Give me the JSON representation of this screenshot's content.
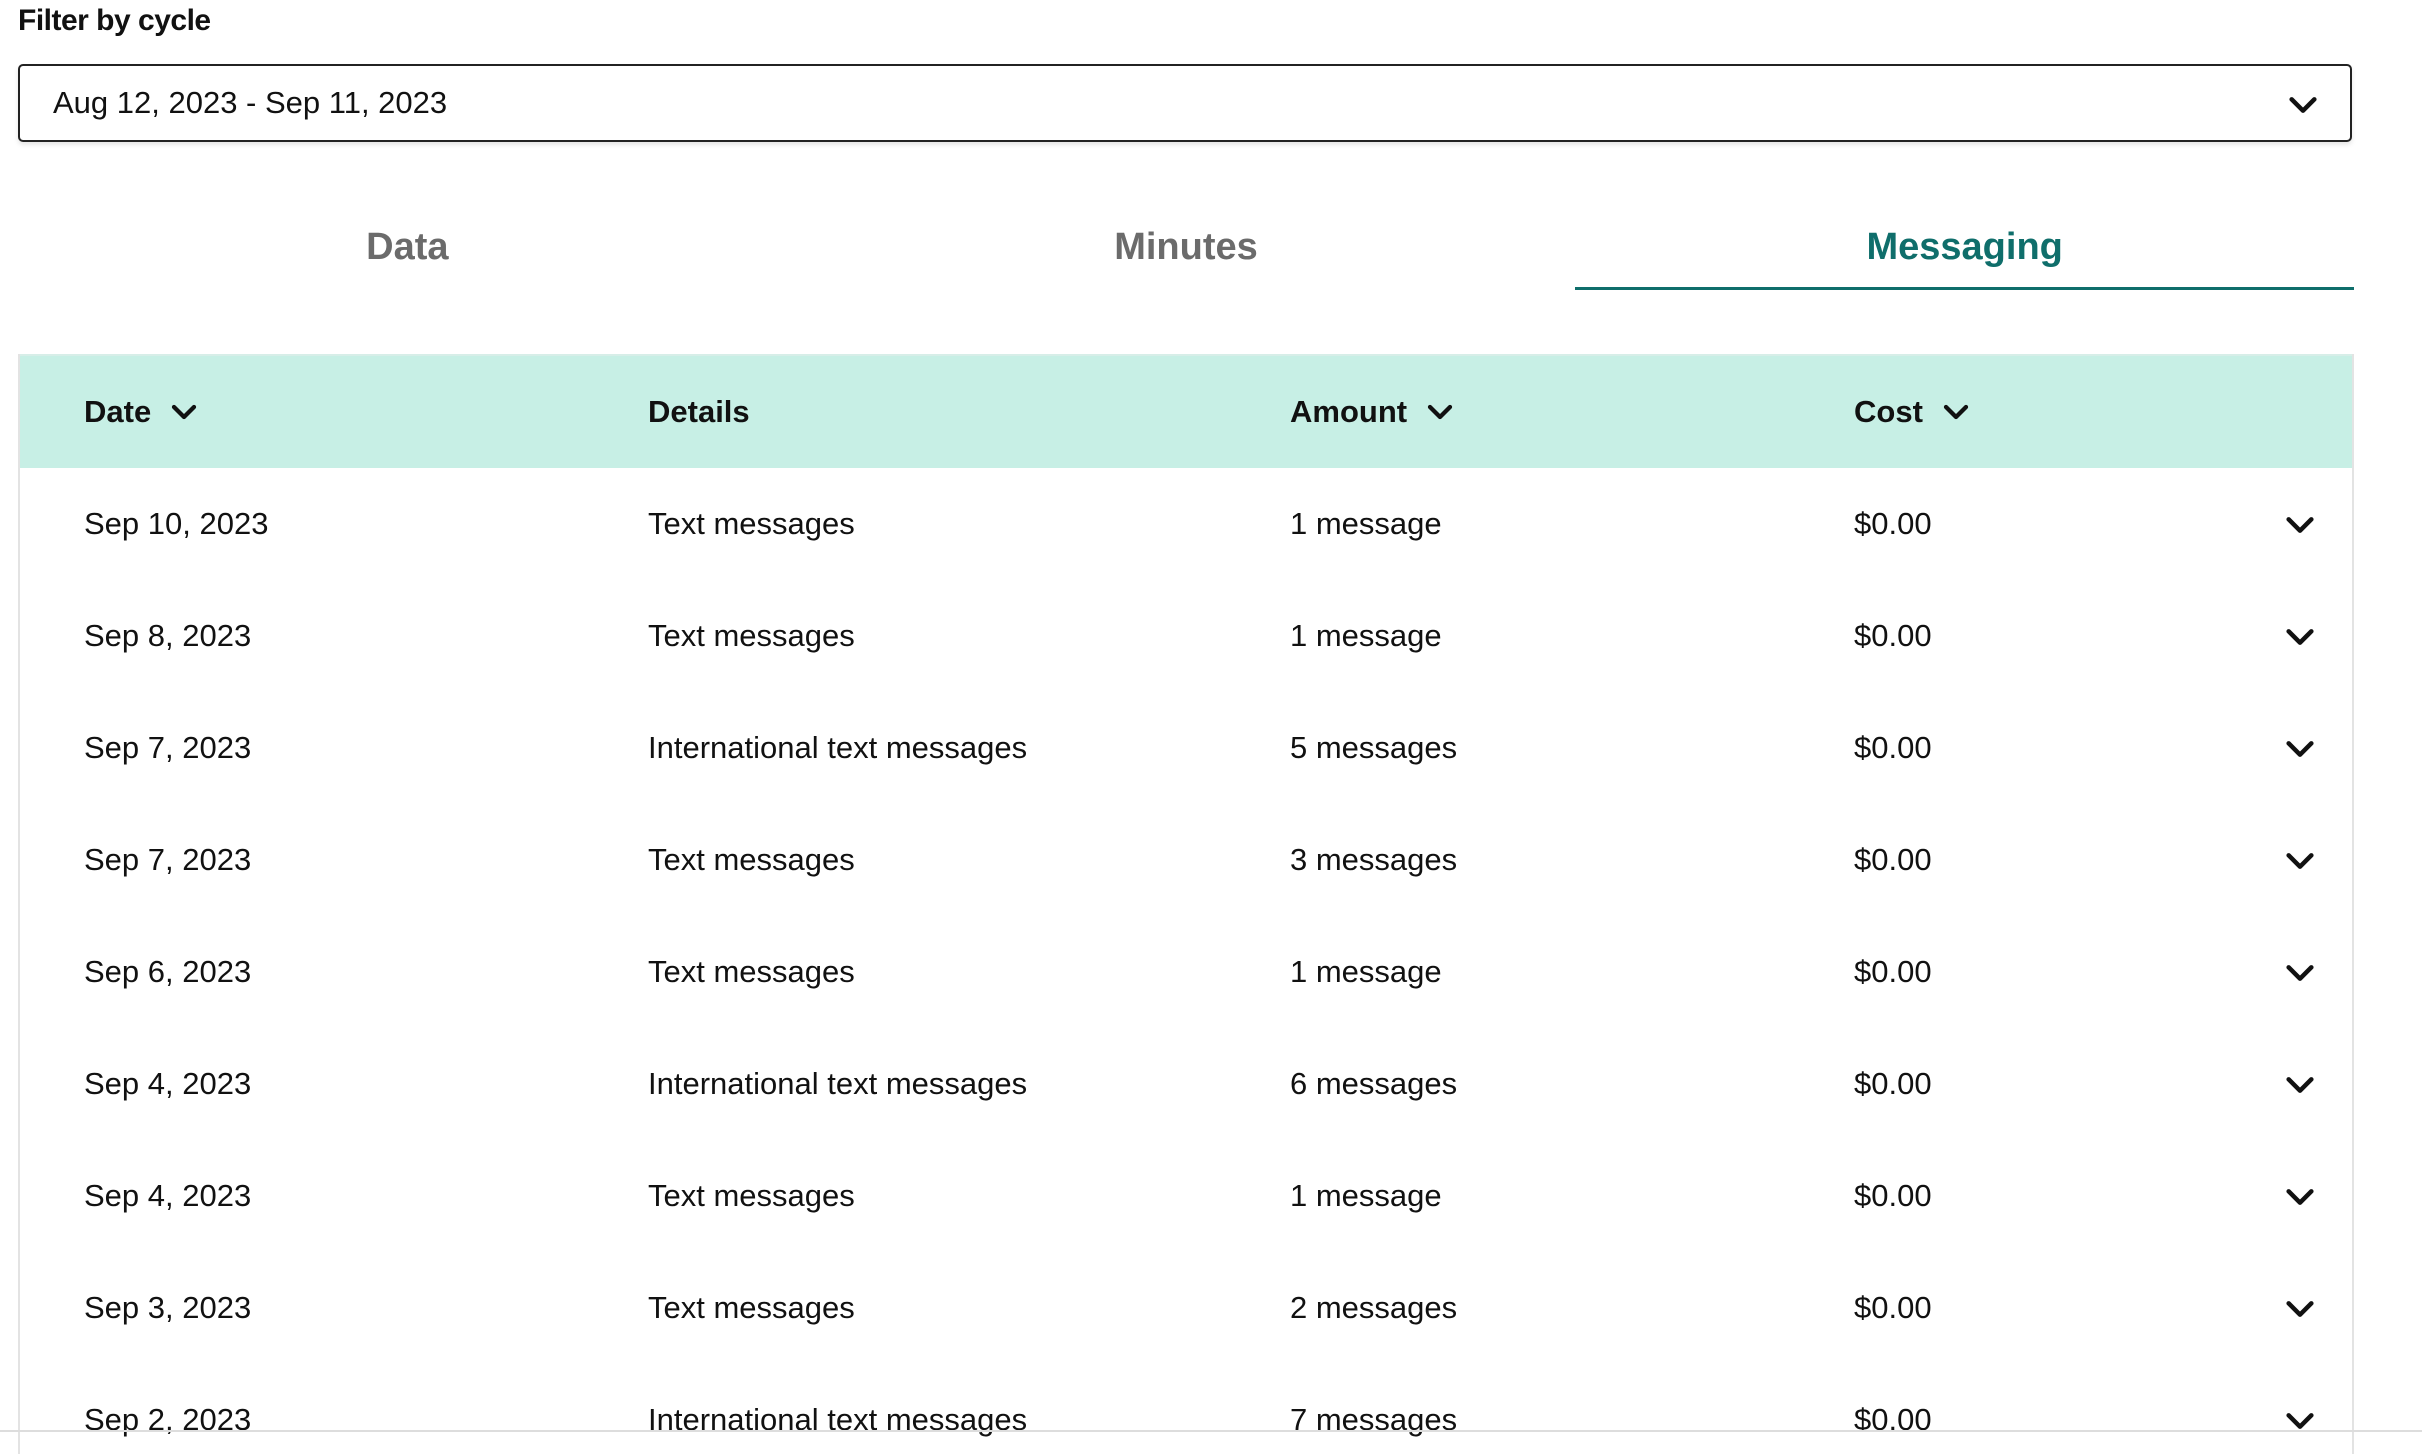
{
  "filter": {
    "label": "Filter by cycle",
    "selected": "Aug 12, 2023 - Sep 11, 2023"
  },
  "tabs": [
    {
      "label": "Data",
      "active": false
    },
    {
      "label": "Minutes",
      "active": false
    },
    {
      "label": "Messaging",
      "active": true
    }
  ],
  "table": {
    "headers": {
      "date": "Date",
      "details": "Details",
      "amount": "Amount",
      "cost": "Cost"
    },
    "rows": [
      {
        "date": "Sep 10, 2023",
        "details": "Text messages",
        "amount": "1 message",
        "cost": "$0.00"
      },
      {
        "date": "Sep 8, 2023",
        "details": "Text messages",
        "amount": "1 message",
        "cost": "$0.00"
      },
      {
        "date": "Sep 7, 2023",
        "details": "International text messages",
        "amount": "5 messages",
        "cost": "$0.00"
      },
      {
        "date": "Sep 7, 2023",
        "details": "Text messages",
        "amount": "3 messages",
        "cost": "$0.00"
      },
      {
        "date": "Sep 6, 2023",
        "details": "Text messages",
        "amount": "1 message",
        "cost": "$0.00"
      },
      {
        "date": "Sep 4, 2023",
        "details": "International text messages",
        "amount": "6 messages",
        "cost": "$0.00"
      },
      {
        "date": "Sep 4, 2023",
        "details": "Text messages",
        "amount": "1 message",
        "cost": "$0.00"
      },
      {
        "date": "Sep 3, 2023",
        "details": "Text messages",
        "amount": "2 messages",
        "cost": "$0.00"
      },
      {
        "date": "Sep 2, 2023",
        "details": "International text messages",
        "amount": "7 messages",
        "cost": "$0.00"
      }
    ]
  },
  "colors": {
    "accent": "#0f6e6b",
    "header_bg": "#c7efe5",
    "inactive_tab": "#6b6b6b"
  },
  "icons": {
    "select": "chevron-down-icon",
    "sort": "chevron-down-icon",
    "row_expand": "chevron-down-icon"
  }
}
